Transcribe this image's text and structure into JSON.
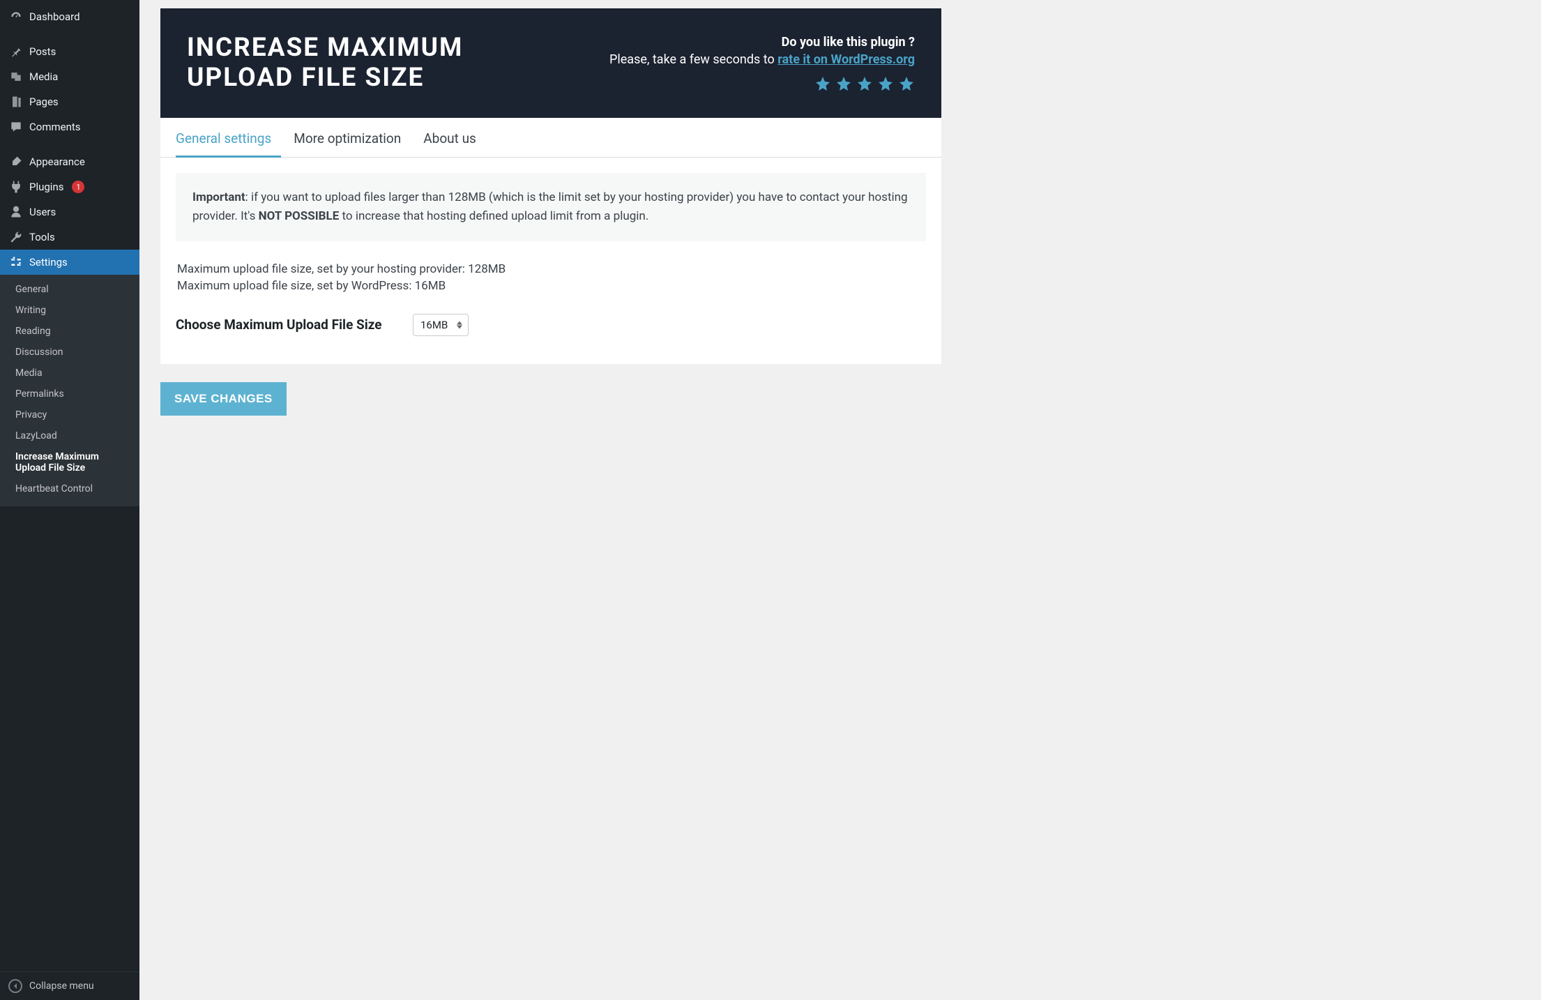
{
  "sidebar": {
    "items": [
      {
        "icon": "dashboard",
        "label": "Dashboard"
      },
      {
        "icon": "pin",
        "label": "Posts"
      },
      {
        "icon": "media",
        "label": "Media"
      },
      {
        "icon": "pages",
        "label": "Pages"
      },
      {
        "icon": "comment",
        "label": "Comments"
      },
      {
        "icon": "brush",
        "label": "Appearance"
      },
      {
        "icon": "plug",
        "label": "Plugins",
        "badge": "1"
      },
      {
        "icon": "user",
        "label": "Users"
      },
      {
        "icon": "wrench",
        "label": "Tools"
      },
      {
        "icon": "sliders",
        "label": "Settings",
        "current": true
      }
    ],
    "submenu": [
      "General",
      "Writing",
      "Reading",
      "Discussion",
      "Media",
      "Permalinks",
      "Privacy",
      "LazyLoad",
      "Increase Maximum Upload File Size",
      "Heartbeat Control"
    ],
    "submenu_current": "Increase Maximum Upload File Size",
    "collapse_label": "Collapse menu"
  },
  "banner": {
    "title": "INCREASE MAXIMUM UPLOAD FILE SIZE",
    "question": "Do you like this plugin ?",
    "please_prefix": "Please, take a few seconds to ",
    "rate_link": "rate it on WordPress.org"
  },
  "tabs": {
    "general": "General settings",
    "more": "More optimization",
    "about": "About us"
  },
  "notice": {
    "important_label": "Important",
    "text1": ": if you want to upload files larger than 128MB (which is the limit set by your hosting provider) you have to contact your hosting provider. It's ",
    "not_possible": "NOT POSSIBLE",
    "text2": " to increase that hosting defined upload limit from a plugin."
  },
  "info": {
    "host_line": "Maximum upload file size, set by your hosting provider: 128MB",
    "wp_line": "Maximum upload file size, set by WordPress: 16MB"
  },
  "field": {
    "label": "Choose Maximum Upload File Size",
    "value": "16MB"
  },
  "buttons": {
    "save": "SAVE CHANGES"
  }
}
